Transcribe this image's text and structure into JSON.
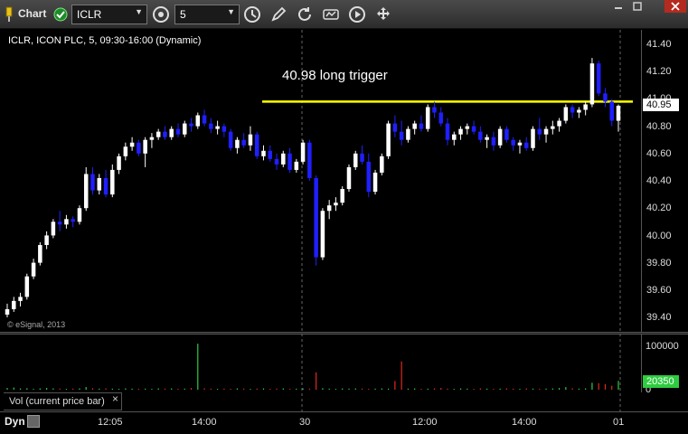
{
  "toolbar": {
    "title": "Chart",
    "symbol": "ICLR",
    "interval": "5",
    "icons": [
      "link-pin-icon",
      "symbol-link-icon",
      "interval-clock-icon",
      "draw-pencil-icon",
      "refresh-icon",
      "study-icon",
      "play-icon",
      "cursor-drag-icon"
    ]
  },
  "chart": {
    "header": "ICLR, ICON PLC, 5, 09:30-16:00 (Dynamic)",
    "copyright": "© eSignal, 2013",
    "annotation": "40.98 long trigger",
    "last_price": "40.95",
    "price_ticks": [
      "41.40",
      "41.20",
      "41.00",
      "40.80",
      "40.60",
      "40.40",
      "40.20",
      "40.00",
      "39.80",
      "39.60",
      "39.40"
    ],
    "volume_ticks": [
      "100000",
      "0"
    ],
    "volume_last": "20350",
    "volume_legend": "Vol (current price bar)",
    "volume_legend_close": "×",
    "time_ticks": [
      "12:05",
      "14:00",
      "30",
      "12:00",
      "14:00",
      "01"
    ],
    "dyn_label": "Dyn",
    "colors": {
      "up": "#ffffff",
      "down": "#1f1fff",
      "trigger_line": "#ffff00",
      "volume_up": "#2ecc40",
      "volume_down": "#e0281e",
      "background": "#000000"
    }
  },
  "chart_data": {
    "type": "candlestick",
    "trigger_level": 40.98,
    "price_range": [
      39.35,
      41.45
    ],
    "volume_range": [
      0,
      115000
    ],
    "bars": [
      [
        39.42,
        39.5,
        39.4,
        39.46
      ],
      [
        39.46,
        39.55,
        39.44,
        39.52
      ],
      [
        39.52,
        39.58,
        39.48,
        39.55
      ],
      [
        39.55,
        39.72,
        39.53,
        39.7
      ],
      [
        39.7,
        39.83,
        39.68,
        39.8
      ],
      [
        39.8,
        39.95,
        39.78,
        39.93
      ],
      [
        39.93,
        40.03,
        39.9,
        40.0
      ],
      [
        40.0,
        40.12,
        39.98,
        40.1
      ],
      [
        40.1,
        40.18,
        40.03,
        40.08
      ],
      [
        40.08,
        40.15,
        40.05,
        40.12
      ],
      [
        40.12,
        40.14,
        40.06,
        40.1
      ],
      [
        40.1,
        40.22,
        40.08,
        40.2
      ],
      [
        40.2,
        40.5,
        40.18,
        40.45
      ],
      [
        40.45,
        40.5,
        40.3,
        40.33
      ],
      [
        40.33,
        40.45,
        40.3,
        40.42
      ],
      [
        40.42,
        40.48,
        40.28,
        40.3
      ],
      [
        40.3,
        40.52,
        40.28,
        40.48
      ],
      [
        40.48,
        40.6,
        40.45,
        40.58
      ],
      [
        40.58,
        40.68,
        40.55,
        40.65
      ],
      [
        40.65,
        40.72,
        40.62,
        40.68
      ],
      [
        40.68,
        40.7,
        40.58,
        40.6
      ],
      [
        40.6,
        40.72,
        40.5,
        40.7
      ],
      [
        40.7,
        40.75,
        40.64,
        40.72
      ],
      [
        40.72,
        40.78,
        40.7,
        40.76
      ],
      [
        40.76,
        40.8,
        40.7,
        40.72
      ],
      [
        40.72,
        40.8,
        40.7,
        40.78
      ],
      [
        40.78,
        40.82,
        40.72,
        40.74
      ],
      [
        40.74,
        40.84,
        40.72,
        40.82
      ],
      [
        40.82,
        40.86,
        40.76,
        40.8
      ],
      [
        40.8,
        40.9,
        40.78,
        40.88
      ],
      [
        40.88,
        40.92,
        40.8,
        40.82
      ],
      [
        40.82,
        40.86,
        40.75,
        40.78
      ],
      [
        40.78,
        40.84,
        40.74,
        40.8
      ],
      [
        40.8,
        40.82,
        40.72,
        40.76
      ],
      [
        40.76,
        40.78,
        40.62,
        40.64
      ],
      [
        40.64,
        40.72,
        40.6,
        40.7
      ],
      [
        40.7,
        40.75,
        40.64,
        40.66
      ],
      [
        40.66,
        40.8,
        40.62,
        40.74
      ],
      [
        40.74,
        40.76,
        40.56,
        40.58
      ],
      [
        40.58,
        40.66,
        40.55,
        40.62
      ],
      [
        40.62,
        40.66,
        40.54,
        40.56
      ],
      [
        40.56,
        40.6,
        40.48,
        40.52
      ],
      [
        40.52,
        40.62,
        40.5,
        40.6
      ],
      [
        40.6,
        40.64,
        40.46,
        40.48
      ],
      [
        40.48,
        40.56,
        40.46,
        40.54
      ],
      [
        40.54,
        40.7,
        40.52,
        40.68
      ],
      [
        40.68,
        40.7,
        40.4,
        40.42
      ],
      [
        40.42,
        40.44,
        39.78,
        39.84
      ],
      [
        39.84,
        40.2,
        39.82,
        40.18
      ],
      [
        40.18,
        40.26,
        40.12,
        40.22
      ],
      [
        40.22,
        40.28,
        40.18,
        40.24
      ],
      [
        40.24,
        40.36,
        40.22,
        40.34
      ],
      [
        40.34,
        40.52,
        40.32,
        40.5
      ],
      [
        40.5,
        40.62,
        40.48,
        40.6
      ],
      [
        40.6,
        40.66,
        40.52,
        40.54
      ],
      [
        40.54,
        40.6,
        40.28,
        40.32
      ],
      [
        40.32,
        40.48,
        40.3,
        40.46
      ],
      [
        40.46,
        40.6,
        40.44,
        40.58
      ],
      [
        40.58,
        40.84,
        40.56,
        40.82
      ],
      [
        40.82,
        40.88,
        40.72,
        40.76
      ],
      [
        40.76,
        40.84,
        40.66,
        40.7
      ],
      [
        40.7,
        40.8,
        40.68,
        40.78
      ],
      [
        40.78,
        40.84,
        40.74,
        40.82
      ],
      [
        40.82,
        40.88,
        40.76,
        40.78
      ],
      [
        40.78,
        40.96,
        40.76,
        40.94
      ],
      [
        40.94,
        40.98,
        40.86,
        40.9
      ],
      [
        40.9,
        40.94,
        40.8,
        40.82
      ],
      [
        40.82,
        40.86,
        40.66,
        40.7
      ],
      [
        40.7,
        40.76,
        40.66,
        40.74
      ],
      [
        40.74,
        40.8,
        40.7,
        40.78
      ],
      [
        40.78,
        40.82,
        40.74,
        40.8
      ],
      [
        40.8,
        40.84,
        40.74,
        40.76
      ],
      [
        40.76,
        40.8,
        40.68,
        40.7
      ],
      [
        40.7,
        40.74,
        40.64,
        40.72
      ],
      [
        40.72,
        40.76,
        40.62,
        40.66
      ],
      [
        40.66,
        40.8,
        40.64,
        40.78
      ],
      [
        40.78,
        40.8,
        40.68,
        40.7
      ],
      [
        40.7,
        40.72,
        40.62,
        40.66
      ],
      [
        40.66,
        40.7,
        40.6,
        40.68
      ],
      [
        40.68,
        40.72,
        40.62,
        40.64
      ],
      [
        40.64,
        40.8,
        40.62,
        40.78
      ],
      [
        40.78,
        40.86,
        40.7,
        40.74
      ],
      [
        40.74,
        40.8,
        40.68,
        40.78
      ],
      [
        40.78,
        40.84,
        40.74,
        40.8
      ],
      [
        40.8,
        40.86,
        40.76,
        40.84
      ],
      [
        40.84,
        40.96,
        40.82,
        40.94
      ],
      [
        40.94,
        40.96,
        40.86,
        40.9
      ],
      [
        40.9,
        40.94,
        40.86,
        40.92
      ],
      [
        40.92,
        40.98,
        40.88,
        40.96
      ],
      [
        40.96,
        41.3,
        40.94,
        41.26
      ],
      [
        41.26,
        41.28,
        41.02,
        41.04
      ],
      [
        41.04,
        41.08,
        40.94,
        40.98
      ],
      [
        40.98,
        41.0,
        40.8,
        40.84
      ],
      [
        40.84,
        40.96,
        40.76,
        40.95
      ]
    ],
    "volumes": [
      4000,
      5000,
      3000,
      3500,
      2000,
      3000,
      4000,
      3000,
      2500,
      2000,
      2500,
      3000,
      6000,
      3500,
      2500,
      3000,
      2500,
      2000,
      3000,
      2500,
      2000,
      2500,
      2000,
      3000,
      2500,
      3000,
      2000,
      2500,
      4000,
      106000,
      3000,
      2500,
      2000,
      2500,
      2000,
      3000,
      2500,
      2000,
      2500,
      3000,
      2000,
      2500,
      3000,
      2000,
      2500,
      3000,
      2500,
      40000,
      3500,
      2500,
      2000,
      3000,
      2500,
      3000,
      2500,
      2000,
      2500,
      3000,
      2500,
      20000,
      65000,
      2500,
      3000,
      2000,
      2500,
      3000,
      4000,
      2500,
      2000,
      3000,
      2500,
      2000,
      3000,
      2500,
      2000,
      2500,
      3000,
      2500,
      2000,
      3000,
      2500,
      2000,
      2500,
      3000,
      4000,
      6000,
      3000,
      2500,
      3000,
      16000,
      15000,
      13000,
      9000,
      20350
    ]
  }
}
